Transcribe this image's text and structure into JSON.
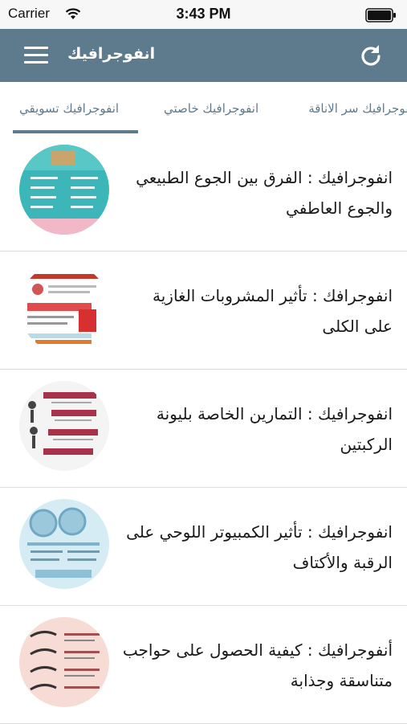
{
  "status_bar": {
    "carrier": "Carrier",
    "time": "3:43 PM"
  },
  "navbar": {
    "title": "انفوجرافيك",
    "menu_icon": "hamburger-icon",
    "refresh_icon": "refresh-icon"
  },
  "tabs": [
    {
      "label": "انفوجرافيك تسويقي",
      "active": true
    },
    {
      "label": "انفوجرافيك خاصتي",
      "active": false
    },
    {
      "label": "انفوجرافيك سر الاناقة",
      "active": false
    }
  ],
  "articles": [
    {
      "title": "انفوجرافيك : الفرق بين الجوع الطبيعي والجوع العاطفي"
    },
    {
      "title": "انفوجرافك : تأثير المشروبات الغازية على الكلى"
    },
    {
      "title": "انفوجرافيك : التمارين الخاصة بليونة الركبتين"
    },
    {
      "title": "انفوجرافيك : تأثير الكمبيوتر اللوحي على الرقبة والأكتاف"
    },
    {
      "title": "أنفوجرافيك : كيفية الحصول على حواجب متناسقة وجذابة"
    }
  ],
  "colors": {
    "primary": "#5e7b8d",
    "divider": "#dcdcdc"
  }
}
